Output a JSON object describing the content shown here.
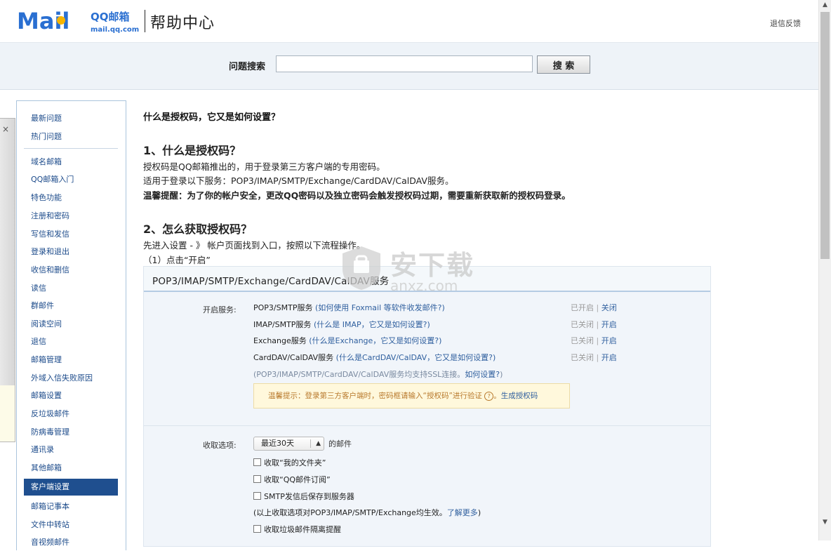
{
  "header": {
    "brand": "Mail",
    "brand_cn": "QQ邮箱",
    "brand_url": "mail.qq.com",
    "title": "帮助中心",
    "feedback_link": "退信反馈"
  },
  "search": {
    "label": "问题搜索",
    "value": "",
    "placeholder": "",
    "button_label": "搜 索"
  },
  "sidebar": {
    "items": [
      {
        "label": "最新问题"
      },
      {
        "label": "热门问题"
      },
      {
        "label": "域名邮箱"
      },
      {
        "label": "QQ邮箱入门"
      },
      {
        "label": "特色功能"
      },
      {
        "label": "注册和密码"
      },
      {
        "label": "写信和发信"
      },
      {
        "label": "登录和退出"
      },
      {
        "label": "收信和删信"
      },
      {
        "label": "读信"
      },
      {
        "label": "群邮件"
      },
      {
        "label": "阅读空间"
      },
      {
        "label": "退信"
      },
      {
        "label": "邮箱管理"
      },
      {
        "label": "外域入信失败原因"
      },
      {
        "label": "邮箱设置"
      },
      {
        "label": "反垃圾邮件"
      },
      {
        "label": "防病毒管理"
      },
      {
        "label": "通讯录"
      },
      {
        "label": "其他邮箱"
      },
      {
        "label": "客户端设置",
        "active": true
      },
      {
        "label": "邮箱记事本"
      },
      {
        "label": "文件中转站"
      },
      {
        "label": "音视频邮件"
      }
    ]
  },
  "popup": {
    "close_glyph": "×"
  },
  "article": {
    "title": "什么是授权码，它又是如何设置？",
    "section1_heading": "1、什么是授权码？",
    "section1_p1": "授权码是QQ邮箱推出的，用于登录第三方客户端的专用密码。",
    "section1_p2": "适用于登录以下服务：POP3/IMAP/SMTP/Exchange/CardDAV/CalDAV服务。",
    "section1_tip": "温馨提醒：为了你的帐户安全，更改QQ密码以及独立密码会触发授权码过期，需要重新获取新的授权码登录。",
    "section2_heading": "2、怎么获取授权码？",
    "section2_p1": "先进入设置 - 》 帐户页面找到入口，按照以下流程操作。",
    "section2_step1": "（1）点击“开启”"
  },
  "panel": {
    "title": "POP3/IMAP/SMTP/Exchange/CardDAV/CalDAV服务",
    "services_label": "开启服务:",
    "services": [
      {
        "name": "POP3/SMTP服务",
        "help": "(如何使用 Foxmail 等软件收发邮件?)",
        "status": "已开启",
        "action": "关闭"
      },
      {
        "name": "IMAP/SMTP服务",
        "help": "(什么是 IMAP，它又是如何设置?)",
        "status": "已关闭",
        "action": "开启"
      },
      {
        "name": "Exchange服务",
        "help": "(什么是Exchange，它又是如何设置?)",
        "status": "已关闭",
        "action": "开启"
      },
      {
        "name": "CardDAV/CalDAV服务",
        "help": "(什么是CardDAV/CalDAV，它又是如何设置?)",
        "status": "已关闭",
        "action": "开启"
      }
    ],
    "status_separator": "|",
    "ssl_note": "(POP3/IMAP/SMTP/CardDAV/CalDAV服务均支持SSL连接。",
    "ssl_link": "如何设置?",
    "ssl_close": ")",
    "tip_text": "温馨提示：登录第三方客户端时，密码框请输入“授权码”进行验证",
    "tip_help_glyph": "?",
    "tip_link": "生成授权码",
    "receive_label": "收取选项:",
    "receive_select": "最近30天",
    "receive_suffix": "的邮件",
    "checkboxes": [
      {
        "label": "收取“我的文件夹”"
      },
      {
        "label": "收取“QQ邮件订阅”"
      },
      {
        "label": "SMTP发信后保存到服务器"
      }
    ],
    "effect_note": "(以上收取选项对POP3/IMAP/SMTP/Exchange均生效。",
    "effect_link": "了解更多",
    "effect_close": ")",
    "spam_checkbox": "收取垃圾邮件隔离提醒"
  },
  "watermark": {
    "text": "安下载",
    "url": "anxz.com"
  },
  "colors": {
    "accent": "#1f4f8f",
    "link": "#2f5f9e",
    "tip_bg": "#fff8dc",
    "logo_blue": "#2a6fd1"
  }
}
